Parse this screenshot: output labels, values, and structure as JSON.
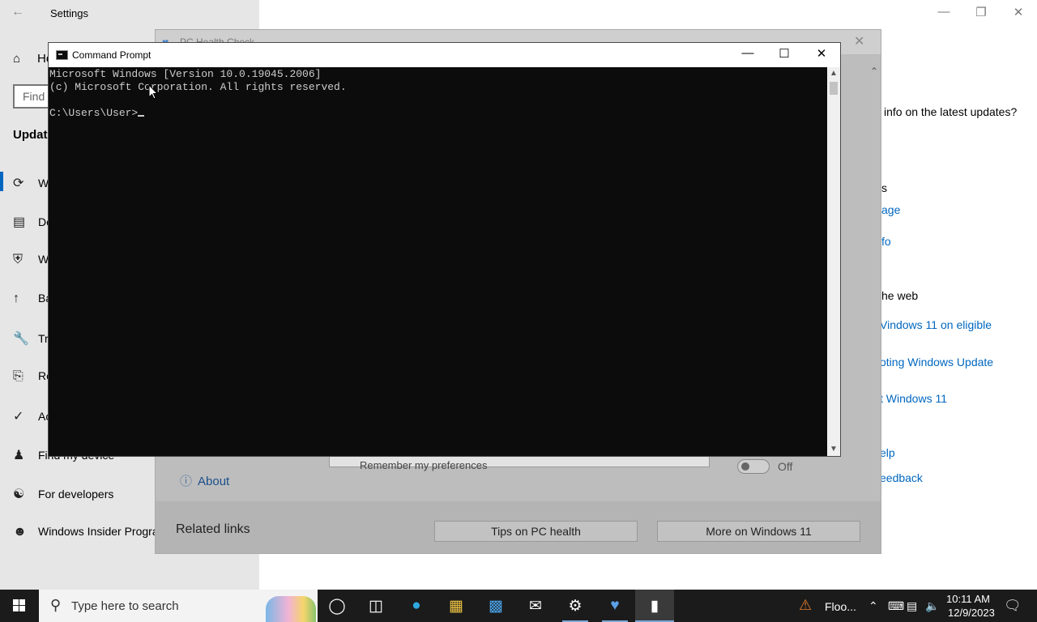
{
  "settings": {
    "window_title": "Settings",
    "home_label": "Home",
    "find_placeholder": "Find",
    "section_heading": "Update",
    "sidebar_items": [
      {
        "label": "W",
        "icon": "sync-icon"
      },
      {
        "label": "De",
        "icon": "delivery-icon"
      },
      {
        "label": "W",
        "icon": "shield-icon"
      },
      {
        "label": "Ba",
        "icon": "backup-icon"
      },
      {
        "label": "Tr",
        "icon": "wrench-icon"
      },
      {
        "label": "Re",
        "icon": "recovery-icon"
      },
      {
        "label": "Ac",
        "icon": "check-circle-icon"
      },
      {
        "label": "Find my device",
        "icon": "person-locate-icon"
      },
      {
        "label": "For developers",
        "icon": "developer-icon"
      },
      {
        "label": "Windows Insider Progra",
        "icon": "insider-icon"
      }
    ],
    "right_panel": {
      "question": "info on the latest updates?",
      "s_text": "s",
      "link_age": "age",
      "link_fo": "fo",
      "web_heading": "he web",
      "link_eligible": "Vindows 11 on eligible",
      "link_troubleshoot": "oting Windows Update",
      "link_win11": "t Windows 11",
      "link_help": "elp",
      "link_feedback": "eedback"
    }
  },
  "pc_health_check": {
    "window_title": "PC Health Check",
    "about_label": "About",
    "popup_text": "Remember my preferences",
    "toggle_label": "Off",
    "related_links": "Related links",
    "tips_button": "Tips on PC health",
    "more_button": "More on Windows 11"
  },
  "cmd": {
    "window_title": "Command Prompt",
    "line1": "Microsoft Windows [Version 10.0.19045.2006]",
    "line2": "(c) Microsoft Corporation. All rights reserved.",
    "prompt": "C:\\Users\\User>"
  },
  "taskbar": {
    "search_placeholder": "Type here to search",
    "pinned": [
      "cortana-icon",
      "task-view-icon",
      "edge-icon",
      "file-explorer-icon",
      "store-icon",
      "mail-icon",
      "settings-icon",
      "pc-health-check-icon",
      "command-prompt-icon"
    ],
    "weather_text": "Floo...",
    "time": "10:11 AM",
    "date": "12/9/2023"
  },
  "colors": {
    "accent": "#0067c0",
    "console_bg": "#0c0c0c",
    "console_text": "#cccccc",
    "taskbar": "#1b1b1b"
  }
}
